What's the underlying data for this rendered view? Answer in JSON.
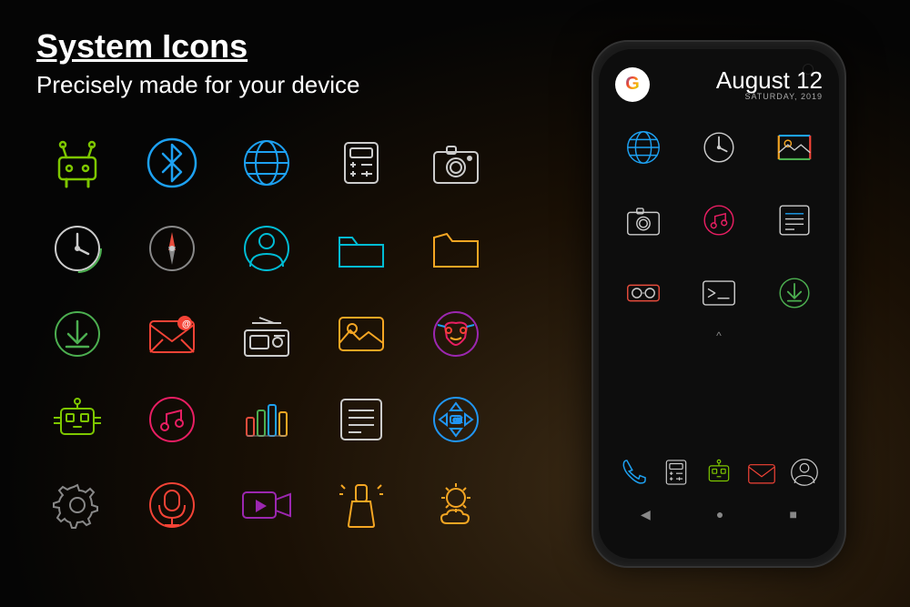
{
  "header": {
    "title": "System Icons",
    "subtitle": "Precisely made for your device"
  },
  "phone": {
    "date": "August 12",
    "day_of_week": "SATURDAY, 2019",
    "google_label": "G"
  },
  "colors": {
    "android_green": "#7ec700",
    "bluetooth_blue": "#1da1f2",
    "globe_blue": "#1da1f2",
    "calc_color": "#e0e0e0",
    "camera_white": "#cccccc",
    "clock_white": "#cccccc",
    "compass_red": "#e74c3c",
    "profile_teal": "#00bcd4",
    "folder_teal": "#00bcd4",
    "folder_yellow": "#f5a623",
    "download_green": "#4caf50",
    "email_red": "#f44336",
    "radio_white": "#cccccc",
    "gallery_yellow": "#f5a623",
    "mask_purple": "#9c27b0",
    "robot_green": "#7ec700",
    "music_pink": "#e91e63",
    "equalizer_multi": "#00bcd4",
    "list_white": "#cccccc",
    "ok_blue": "#2196f3",
    "settings_white": "#888888",
    "mic_red": "#f44336",
    "video_purple": "#9c27b0",
    "flashlight_yellow": "#f5a623",
    "weather_yellow": "#f5a623"
  }
}
